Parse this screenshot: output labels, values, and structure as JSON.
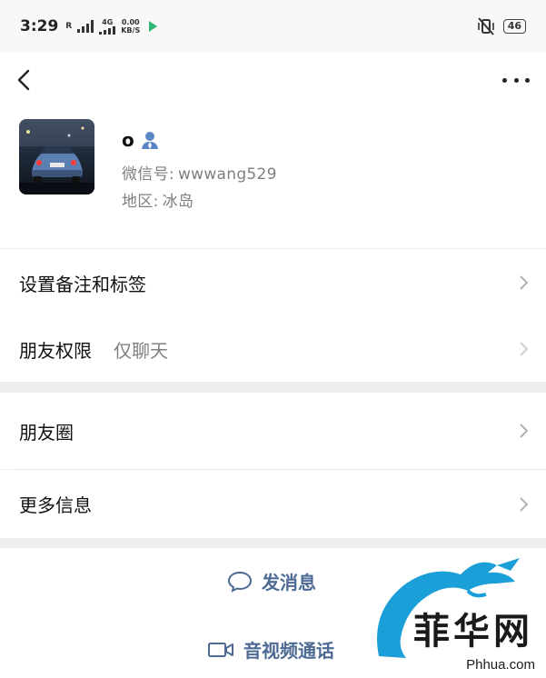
{
  "status_bar": {
    "time": "3:29",
    "carrier_tag": "R",
    "network_label": "4G",
    "speed_value": "0.00",
    "speed_unit": "KB/S",
    "battery": "46"
  },
  "nav": {
    "back_icon": "chevron-left-icon",
    "more_icon": "more-dots-icon"
  },
  "profile": {
    "nickname": "o",
    "wechat_id_label": "微信号:",
    "wechat_id": "wwwang529",
    "region_label": "地区:",
    "region": "冰岛"
  },
  "rows": {
    "remark_tags": "设置备注和标签",
    "permission_label": "朋友权限",
    "permission_value": "仅聊天",
    "moments": "朋友圈",
    "more_info": "更多信息"
  },
  "actions": {
    "send_message": "发消息",
    "av_call": "音视频通话"
  },
  "watermark": {
    "logo_text": "菲华网",
    "url": "Phhua.com"
  },
  "colors": {
    "action_text": "#4d6a94",
    "background": "#ededed",
    "card": "#ffffff",
    "secondary_text": "#7f7f7f",
    "watermark_dragon": "#1b9fd8"
  }
}
